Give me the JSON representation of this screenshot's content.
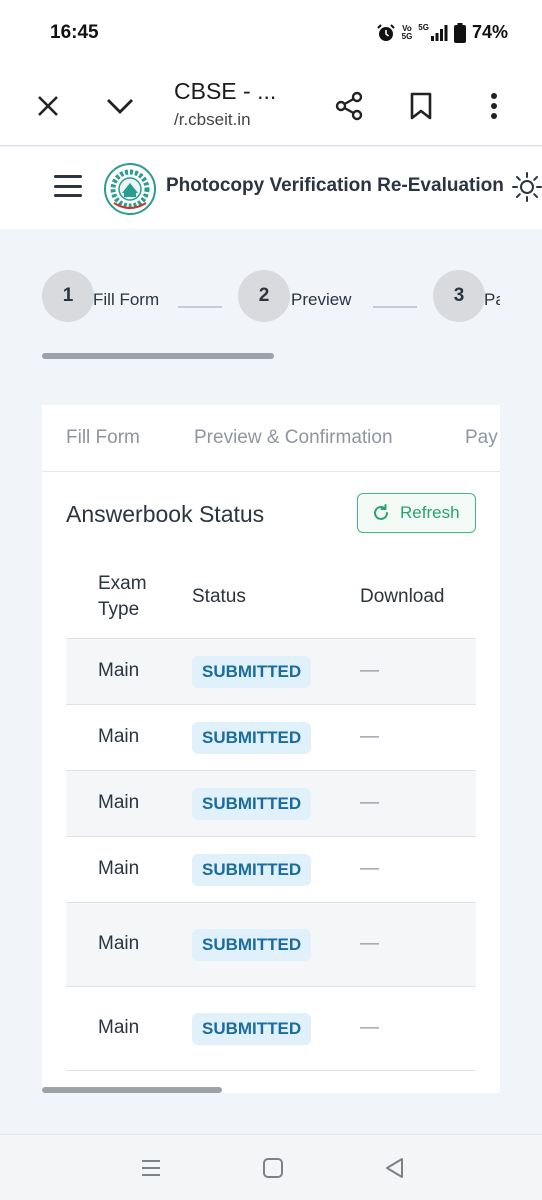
{
  "status_bar": {
    "time": "16:45",
    "battery": "74%",
    "net_top": "Vo",
    "net_bottom": "5G",
    "net_tag": "5G"
  },
  "browser": {
    "title": "CBSE - ...",
    "url": "/r.cbseit.in"
  },
  "header": {
    "title": "Photocopy Verification Re-Evaluation"
  },
  "stepper": [
    {
      "number": "1",
      "label": "Fill Form"
    },
    {
      "number": "2",
      "label": "Preview"
    },
    {
      "number": "3",
      "label": "Pa"
    }
  ],
  "tabs": [
    "Fill Form",
    "Preview & Confirmation",
    "Pay"
  ],
  "answerbook": {
    "title": "Answerbook Status",
    "refresh_label": "Refresh",
    "columns": {
      "exam_type": "Exam Type",
      "status": "Status",
      "download": "Download"
    },
    "rows": [
      {
        "exam_type": "Main",
        "status": "SUBMITTED",
        "download": "—"
      },
      {
        "exam_type": "Main",
        "status": "SUBMITTED",
        "download": "—"
      },
      {
        "exam_type": "Main",
        "status": "SUBMITTED",
        "download": "—"
      },
      {
        "exam_type": "Main",
        "status": "SUBMITTED",
        "download": "—"
      },
      {
        "exam_type": "Main",
        "status": "SUBMITTED",
        "download": "—"
      },
      {
        "exam_type": "Main",
        "status": "SUBMITTED",
        "download": "—"
      }
    ]
  },
  "icons": {
    "close": "close-icon",
    "expand": "chevron-down-icon",
    "share": "share-icon",
    "bookmark": "bookmark-icon",
    "more": "more-vertical-icon",
    "menu": "hamburger-icon",
    "theme": "sun-icon",
    "refresh": "refresh-icon",
    "logo": "cbse-logo",
    "nav_recents": "recents-icon",
    "nav_home": "home-icon",
    "nav_back": "back-icon"
  },
  "colors": {
    "accent": "#27a56b",
    "badge_bg": "#e1f1fb",
    "badge_text": "#1a6c9e",
    "text": "#2b3441",
    "muted": "#8e96a2"
  }
}
